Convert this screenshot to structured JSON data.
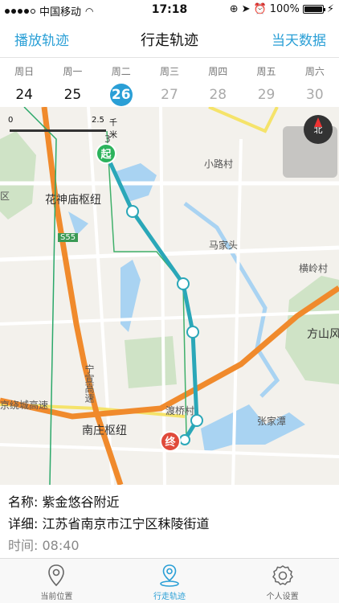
{
  "status_bar": {
    "carrier": "中国移动",
    "time": "17:18",
    "battery": "100%",
    "battery_level": 1.0
  },
  "nav": {
    "left": "播放轨迹",
    "title": "行走轨迹",
    "right": "当天数据"
  },
  "week": [
    {
      "weekday": "周日",
      "date": "24",
      "state": "past"
    },
    {
      "weekday": "周一",
      "date": "25",
      "state": "past"
    },
    {
      "weekday": "周二",
      "date": "26",
      "state": "selected"
    },
    {
      "weekday": "周三",
      "date": "27",
      "state": "future"
    },
    {
      "weekday": "周四",
      "date": "28",
      "state": "future"
    },
    {
      "weekday": "周五",
      "date": "29",
      "state": "future"
    },
    {
      "weekday": "周六",
      "date": "30",
      "state": "future"
    }
  ],
  "map": {
    "scale": {
      "start": "0",
      "mid": "2.5",
      "unit": "千米"
    },
    "compass": "北",
    "start_marker": "起",
    "end_marker": "终",
    "labels": {
      "area_left": "区",
      "small_village": "小路村",
      "huashen": "花神庙枢纽",
      "s55": "S55",
      "majiatou": "马家头",
      "hengling": "横岭村",
      "fangshan": "方山风",
      "ningxuan": "宁宣高速",
      "jingrao": "京绕城高速",
      "dukiao": "渡桥村",
      "zhangjiatan": "张家潭",
      "nanzhuang": "南庄枢纽",
      "route3": "3"
    },
    "colors": {
      "route": "#2aa7b8",
      "start": "#2cb35c",
      "end": "#e04a3b",
      "highway": "#f08a2c",
      "water": "#a9d3f2",
      "green": "#cde3c4"
    }
  },
  "info": {
    "name_label": "名称:",
    "name_value": "紫金悠谷附近",
    "detail_label": "详细:",
    "detail_value": "江苏省南京市江宁区秣陵街道",
    "time_label": "时间:",
    "time_value": "08:40"
  },
  "tabs": [
    {
      "label": "当前位置",
      "icon": "location-pin-icon",
      "active": false
    },
    {
      "label": "行走轨迹",
      "icon": "route-pin-icon",
      "active": true
    },
    {
      "label": "个人设置",
      "icon": "gear-icon",
      "active": false
    }
  ]
}
